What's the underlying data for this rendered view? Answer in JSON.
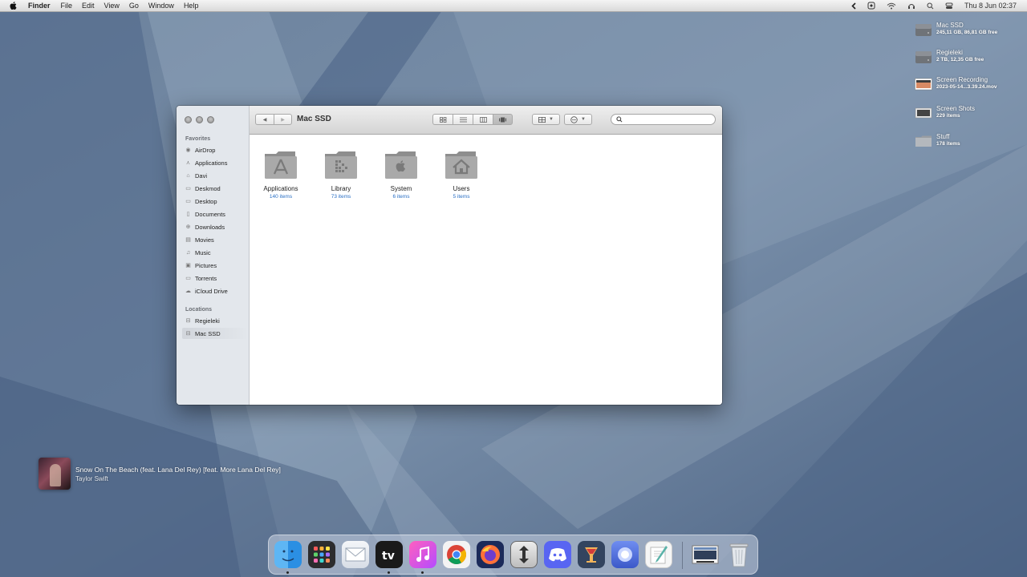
{
  "menubar": {
    "app_name": "Finder",
    "menus": [
      "File",
      "Edit",
      "View",
      "Go",
      "Window",
      "Help"
    ],
    "clock": "Thu 8 Jun  02:37"
  },
  "desktop_items": [
    {
      "name": "Mac SSD",
      "sub": "245,11 GB, 86,81 GB free",
      "icon": "hard-drive-icon"
    },
    {
      "name": "Regieleki",
      "sub": "2 TB, 12,35 GB free",
      "icon": "hard-drive-icon"
    },
    {
      "name": "Screen Recording",
      "sub": "2023-05-14...3.39.24.mov",
      "icon": "video-file-icon"
    },
    {
      "name": "Screen Shots",
      "sub": "229 items",
      "icon": "screenshot-folder-icon"
    },
    {
      "name": "Stuff",
      "sub": "178 items",
      "icon": "folder-icon"
    }
  ],
  "finder": {
    "title": "Mac SSD",
    "search_placeholder": "",
    "favorites_heading": "Favorites",
    "favorites": [
      "AirDrop",
      "Applications",
      "Davi",
      "Deskmod",
      "Desktop",
      "Documents",
      "Downloads",
      "Movies",
      "Music",
      "Pictures",
      "Torrents",
      "iCloud Drive"
    ],
    "locations_heading": "Locations",
    "locations": [
      "Regieleki",
      "Mac SSD"
    ],
    "selected_location": "Mac SSD",
    "items": [
      {
        "name": "Applications",
        "count": "140 items",
        "icon": "applications-folder-icon"
      },
      {
        "name": "Library",
        "count": "73 items",
        "icon": "library-folder-icon"
      },
      {
        "name": "System",
        "count": "6 items",
        "icon": "system-folder-icon"
      },
      {
        "name": "Users",
        "count": "5 items",
        "icon": "users-folder-icon"
      }
    ]
  },
  "now_playing": {
    "title": "Snow On The Beach (feat. Lana Del Rey) [feat. More Lana Del Rey]",
    "artist": "Taylor Swift"
  },
  "dock": {
    "apps": [
      "Finder",
      "Launchpad",
      "Mail",
      "TV",
      "iTunes",
      "Chrome",
      "Firefox",
      "Transmit",
      "Discord",
      "Cocktail",
      "Lasso",
      "TextEdit",
      "Screenshot",
      "Trash"
    ],
    "running": [
      "Finder",
      "TV",
      "iTunes"
    ]
  },
  "colors": {
    "accent_link": "#2a6fc4",
    "window_sidebar": "#e3e7ec",
    "wallpaper": "#5d7490"
  }
}
